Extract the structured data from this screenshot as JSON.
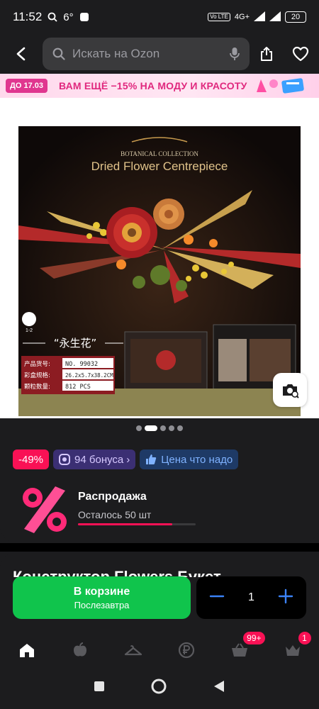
{
  "status_bar": {
    "time": "11:52",
    "temperature": "6°",
    "network": "4G+",
    "battery": "20"
  },
  "search": {
    "placeholder": "Искать на Ozon"
  },
  "promo": {
    "date_badge": "ДО 17.03",
    "text": "ВАМ ЕЩЁ −15% НА МОДУ И КРАСОТУ"
  },
  "product_image": {
    "collection": "BOTANICAL COLLECTION",
    "name": "Dried Flower Centrepiece",
    "chinese_title": "“永生花”",
    "age": "1-2",
    "specs": [
      {
        "label": "产品货号:",
        "value": "NO. 99032"
      },
      {
        "label": "彩盒规格:",
        "value": "26.2x5.7x38.2CM"
      },
      {
        "label": "颗粒数量:",
        "value": "812 PCS"
      }
    ]
  },
  "gallery": {
    "dots": 5,
    "active_index": 1
  },
  "chips": {
    "discount": "-49%",
    "bonus": "94 бонуса",
    "price_label": "Цена что надо"
  },
  "sale": {
    "title": "Распродажа",
    "remaining": "Осталось 50 шт",
    "progress": 0.8
  },
  "product": {
    "title": "Конструктор Flowers Букет"
  },
  "cart": {
    "label": "В корзине",
    "sublabel": "Послезавтра",
    "quantity": "1"
  },
  "tabbar": {
    "cart_badge": "99+",
    "profile_badge": "1"
  },
  "colors": {
    "accent_green": "#10c44c",
    "discount_pink": "#f91155",
    "background": "#1c1c1e"
  }
}
